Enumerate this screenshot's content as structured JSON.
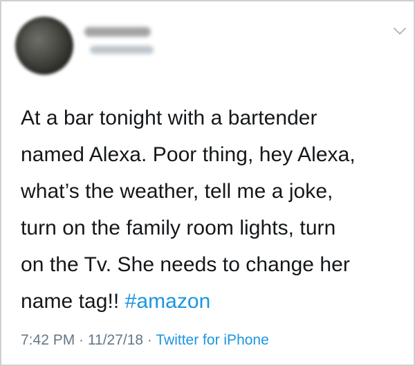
{
  "tweet": {
    "icons": {
      "avatar": "blurred-profile-photo",
      "menu": "chevron-down-icon"
    },
    "body_text": "At a bar tonight with a bartender\nnamed Alexa. Poor thing, hey Alexa,\nwhat’s the weather, tell me a joke,\nturn on the family room  lights, turn\non the Tv. She needs to change her\nname tag!! ",
    "hashtag": "#amazon",
    "time": "7:42 PM",
    "separator": " · ",
    "date": "11/27/18",
    "source": "Twitter for iPhone",
    "colors": {
      "text": "#14171a",
      "link": "#1b95e0",
      "meta": "#657786",
      "border": "#cfcfcf"
    }
  }
}
